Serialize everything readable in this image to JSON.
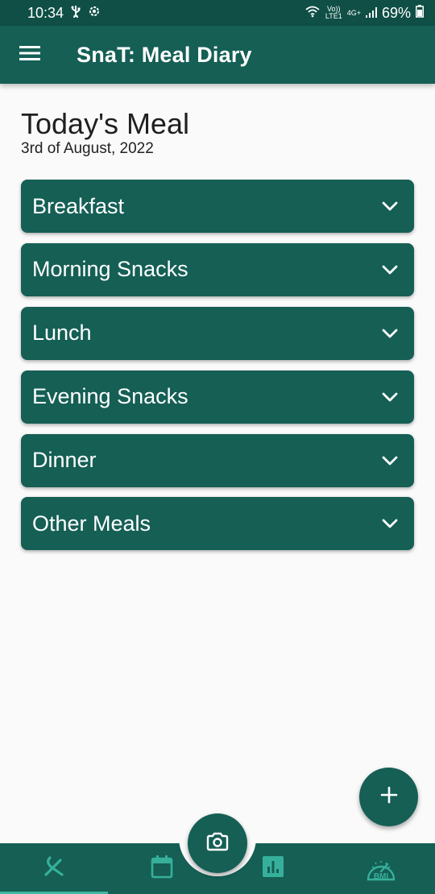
{
  "status_bar": {
    "time": "10:34",
    "volte": "Vo))",
    "lte": "LTE1",
    "network_type": "4G+",
    "battery": "69%",
    "icons": [
      "usb-icon",
      "settings-icon",
      "wifi-icon",
      "signal-icon",
      "battery-icon"
    ]
  },
  "app_bar": {
    "title": "SnaT: Meal Diary",
    "menu_icon": "hamburger-menu-icon"
  },
  "page": {
    "title": "Today's Meal",
    "date": "3rd of August, 2022"
  },
  "meals": [
    {
      "label": "Breakfast"
    },
    {
      "label": "Morning Snacks"
    },
    {
      "label": "Lunch"
    },
    {
      "label": "Evening Snacks"
    },
    {
      "label": "Dinner"
    },
    {
      "label": "Other Meals"
    }
  ],
  "fab": {
    "icon": "plus-icon"
  },
  "camera_button": {
    "icon": "camera-icon"
  },
  "bottom_nav": {
    "items": [
      {
        "icon": "fork-knife-icon",
        "selected": true
      },
      {
        "icon": "calendar-icon",
        "selected": false
      },
      {
        "icon": "bar-chart-icon",
        "selected": false
      },
      {
        "icon": "bmi-gauge-icon",
        "label": "BMI",
        "selected": false
      }
    ]
  },
  "colors": {
    "primary": "#155f55",
    "status_bar": "#0f4f46",
    "nav_icon": "#36b09a",
    "nav_indicator": "#3fb7a2",
    "background": "#fafafa"
  }
}
